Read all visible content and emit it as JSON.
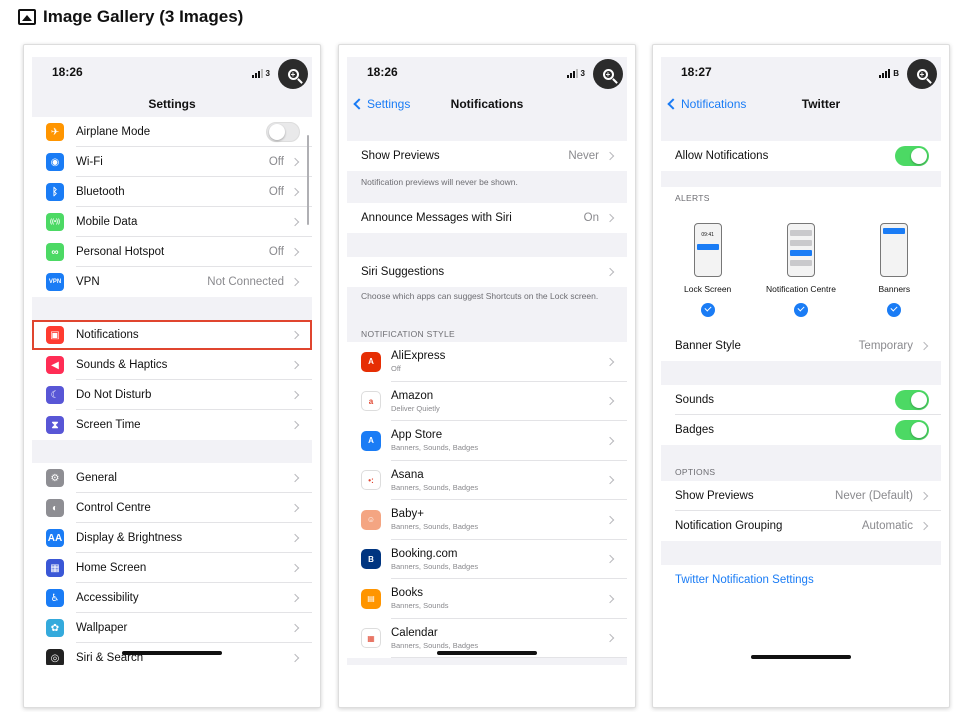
{
  "gallery": {
    "title": "Image Gallery (3 Images)"
  },
  "phone1": {
    "time": "18:26",
    "battery_partial": "3",
    "title": "Settings",
    "group1": [
      {
        "icon": "airplane-icon",
        "color": "#ff9500",
        "glyph": "✈",
        "label": "Airplane Mode",
        "toggle": "off"
      },
      {
        "icon": "wifi-icon",
        "color": "#1a7cf5",
        "glyph": "◉",
        "label": "Wi-Fi",
        "value": "Off"
      },
      {
        "icon": "bluetooth-icon",
        "color": "#1a7cf5",
        "glyph": "ᛒ",
        "label": "Bluetooth",
        "value": "Off"
      },
      {
        "icon": "mobile-data-icon",
        "color": "#4cd964",
        "glyph": "((•))",
        "label": "Mobile Data",
        "value": ""
      },
      {
        "icon": "hotspot-icon",
        "color": "#4cd964",
        "glyph": "∞",
        "label": "Personal Hotspot",
        "value": "Off"
      },
      {
        "icon": "vpn-icon",
        "color": "#1a7cf5",
        "glyph": "VPN",
        "label": "VPN",
        "value": "Not Connected"
      }
    ],
    "group2": [
      {
        "icon": "notifications-icon",
        "color": "#ff3b30",
        "glyph": "▣",
        "label": "Notifications"
      },
      {
        "icon": "sounds-icon",
        "color": "#ff2d55",
        "glyph": "◀",
        "label": "Sounds & Haptics"
      },
      {
        "icon": "moon-icon",
        "color": "#5856d6",
        "glyph": "☾",
        "label": "Do Not Disturb"
      },
      {
        "icon": "hourglass-icon",
        "color": "#5856d6",
        "glyph": "⧗",
        "label": "Screen Time"
      }
    ],
    "group3": [
      {
        "icon": "gear-icon",
        "color": "#8e8e93",
        "glyph": "⚙",
        "label": "General"
      },
      {
        "icon": "control-centre-icon",
        "color": "#8e8e93",
        "glyph": "◐",
        "label": "Control Centre"
      },
      {
        "icon": "display-icon",
        "color": "#1a7cf5",
        "glyph": "AA",
        "label": "Display & Brightness"
      },
      {
        "icon": "home-screen-icon",
        "color": "#3a57d6",
        "glyph": "▦",
        "label": "Home Screen"
      },
      {
        "icon": "accessibility-icon",
        "color": "#1a7cf5",
        "glyph": "♿",
        "label": "Accessibility"
      },
      {
        "icon": "wallpaper-icon",
        "color": "#34aadc",
        "glyph": "✿",
        "label": "Wallpaper"
      },
      {
        "icon": "siri-icon",
        "color": "#222",
        "glyph": "◎",
        "label": "Siri & Search"
      }
    ]
  },
  "phone2": {
    "time": "18:26",
    "battery_partial": "3",
    "back_label": "Settings",
    "title": "Notifications",
    "show_previews": {
      "label": "Show Previews",
      "value": "Never"
    },
    "previews_note": "Notification previews will never be shown.",
    "announce": {
      "label": "Announce Messages with Siri",
      "value": "On"
    },
    "siri_suggestions": {
      "label": "Siri Suggestions"
    },
    "siri_note": "Choose which apps can suggest Shortcuts on the Lock screen.",
    "section": "NOTIFICATION STYLE",
    "apps": [
      {
        "icon": "aliexpress-icon",
        "color": "#e62e04",
        "glyph": "A",
        "name": "AliExpress",
        "sub": "Off"
      },
      {
        "icon": "amazon-icon",
        "color": "#ffffff",
        "glyph": "a",
        "name": "Amazon",
        "sub": "Deliver Quietly"
      },
      {
        "icon": "app-store-icon",
        "color": "#1a7cf5",
        "glyph": "A",
        "name": "App Store",
        "sub": "Banners, Sounds, Badges"
      },
      {
        "icon": "asana-icon",
        "color": "#ffffff",
        "glyph": "•:",
        "name": "Asana",
        "sub": "Banners, Sounds, Badges"
      },
      {
        "icon": "baby-plus-icon",
        "color": "#f4a582",
        "glyph": "☺",
        "name": "Baby+",
        "sub": "Banners, Sounds, Badges"
      },
      {
        "icon": "booking-icon",
        "color": "#003580",
        "glyph": "B",
        "name": "Booking.com",
        "sub": "Banners, Sounds, Badges"
      },
      {
        "icon": "books-icon",
        "color": "#ff9500",
        "glyph": "▤",
        "name": "Books",
        "sub": "Banners, Sounds"
      },
      {
        "icon": "calendar-icon",
        "color": "#ffffff",
        "glyph": "▦",
        "name": "Calendar",
        "sub": "Banners, Sounds, Badges"
      }
    ]
  },
  "phone3": {
    "time": "18:27",
    "battery_partial": "B",
    "back_label": "Notifications",
    "title": "Twitter",
    "allow": {
      "label": "Allow Notifications",
      "toggle": "on"
    },
    "alerts_head": "ALERTS",
    "alert_styles": [
      {
        "label": "Lock Screen",
        "mini_time": "09:41"
      },
      {
        "label": "Notification Centre"
      },
      {
        "label": "Banners"
      }
    ],
    "banner_style": {
      "label": "Banner Style",
      "value": "Temporary"
    },
    "sounds": {
      "label": "Sounds",
      "toggle": "on"
    },
    "badges": {
      "label": "Badges",
      "toggle": "on"
    },
    "options_head": "OPTIONS",
    "show_previews": {
      "label": "Show Previews",
      "value": "Never (Default)"
    },
    "grouping": {
      "label": "Notification Grouping",
      "value": "Automatic"
    },
    "settings_link": "Twitter Notification Settings"
  }
}
